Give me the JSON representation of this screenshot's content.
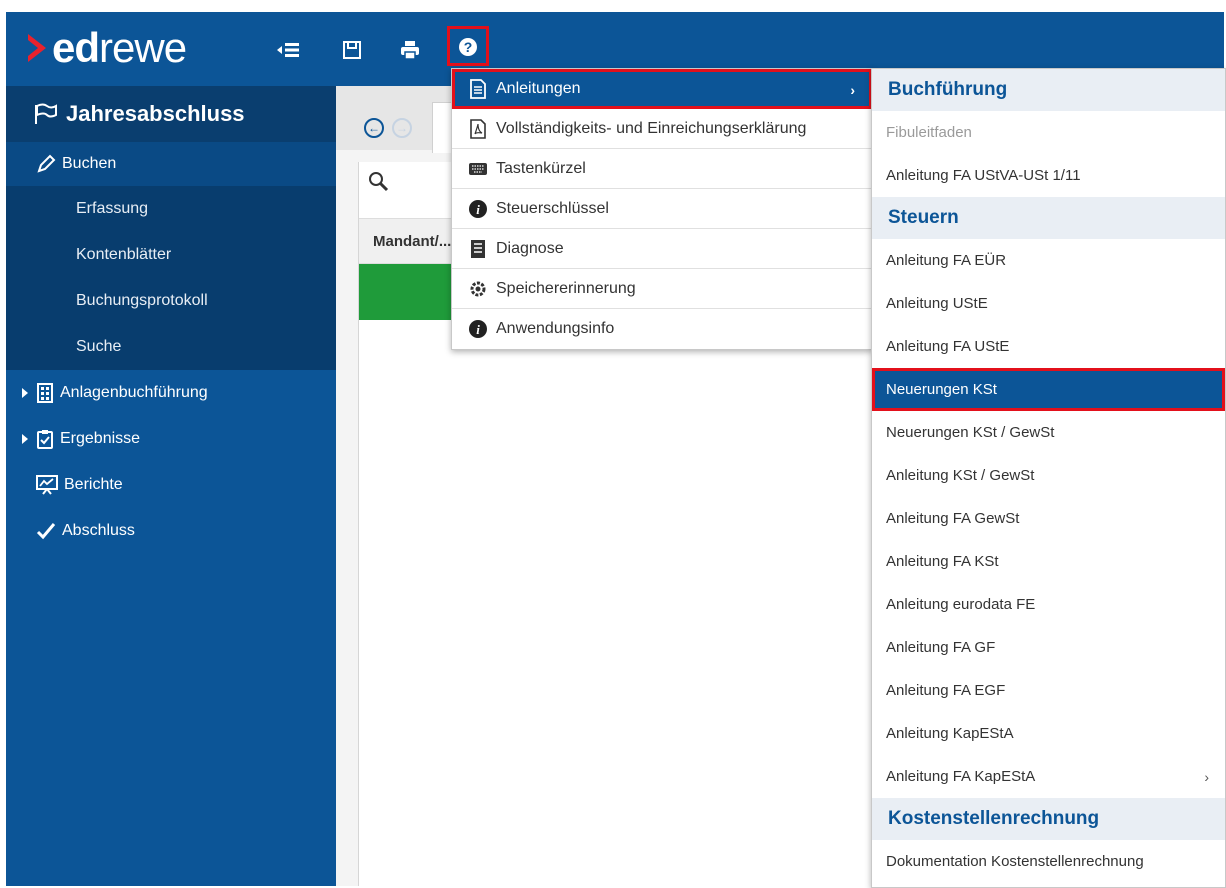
{
  "brand": {
    "prefix": "ed",
    "suffix": "rewe"
  },
  "sidebar": {
    "title": "Jahresabschluss",
    "buchen": "Buchen",
    "sub_items": [
      "Erfassung",
      "Kontenblätter",
      "Buchungsprotokoll",
      "Suche"
    ],
    "anlagen": "Anlagenbuchführung",
    "ergebnisse": "Ergebnisse",
    "berichte": "Berichte",
    "abschluss": "Abschluss"
  },
  "main": {
    "column_header": "Mandant/..."
  },
  "help_menu": {
    "items": [
      {
        "label": "Anleitungen",
        "icon": "document-icon"
      },
      {
        "label": "Vollständigkeits- und Einreichungserklärung",
        "icon": "pdf-icon"
      },
      {
        "label": "Tastenkürzel",
        "icon": "keyboard-icon"
      },
      {
        "label": "Steuerschlüssel",
        "icon": "info-icon"
      },
      {
        "label": "Diagnose",
        "icon": "diagnose-icon"
      },
      {
        "label": "Speichererinnerung",
        "icon": "gear-icon"
      },
      {
        "label": "Anwendungsinfo",
        "icon": "info-icon"
      }
    ]
  },
  "submenu": {
    "sections": [
      {
        "header": "Buchführung",
        "items": [
          "Fibuleitfaden",
          "Anleitung FA UStVA-USt 1/11"
        ]
      },
      {
        "header": "Steuern",
        "items": [
          "Anleitung FA EÜR",
          "Anleitung UStE",
          "Anleitung FA UStE",
          "Neuerungen KSt",
          "Neuerungen KSt / GewSt",
          "Anleitung KSt / GewSt",
          "Anleitung FA GewSt",
          "Anleitung FA KSt",
          "Anleitung eurodata FE",
          "Anleitung FA GF",
          "Anleitung FA EGF",
          "Anleitung KapEStA",
          "Anleitung FA KapEStA"
        ]
      },
      {
        "header": "Kostenstellenrechnung",
        "items": [
          "Dokumentation Kostenstellenrechnung"
        ]
      }
    ]
  },
  "colors": {
    "brand_blue": "#0c5597",
    "highlight_red": "#e3101b",
    "logo_red": "#e8222d",
    "status_green": "#1f9b3a"
  }
}
